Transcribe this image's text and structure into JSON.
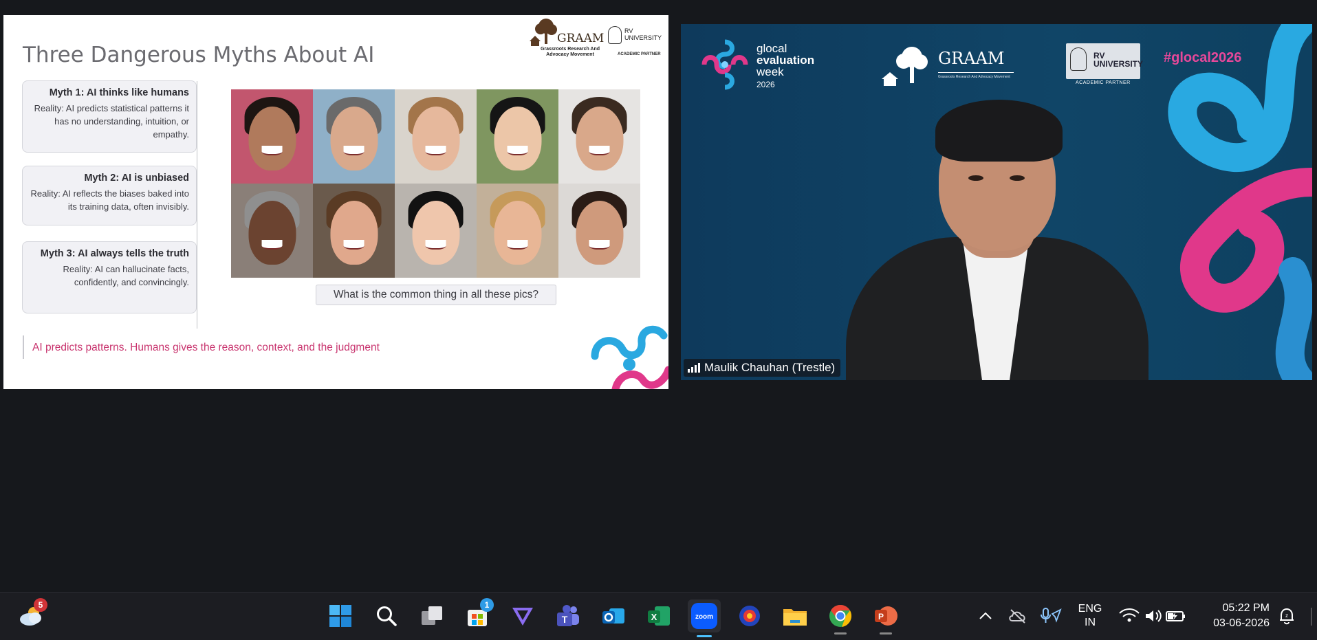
{
  "slide": {
    "title": "Three Dangerous Myths About AI",
    "logo_graam": "GRAAM",
    "logo_graam_sub": "Grassroots Research And Advocacy Movement",
    "logo_rvu": "RV UNIVERSITY",
    "logo_rvu_sub": "ACADEMIC PARTNER",
    "myths": [
      {
        "title": "Myth 1: AI thinks like humans",
        "body": "Reality: AI predicts statistical patterns it has no understanding, intuition, or empathy."
      },
      {
        "title": "Myth 2: AI is unbiased",
        "body": "Reality: AI reflects the biases baked into its training data, often invisibly."
      },
      {
        "title": "Myth 3: AI always tells the truth",
        "body": "Reality: AI can hallucinate facts, confidently, and convincingly."
      }
    ],
    "question": "What is the common thing in all these pics?",
    "footer": "AI predicts patterns. Humans gives the reason, context, and the judgment",
    "faces": [
      {
        "bg": "#c2566e",
        "skin": "#b07a5c",
        "hair": "#1d1512"
      },
      {
        "bg": "#8fb0c8",
        "skin": "#d9a98c",
        "hair": "#6a6a6a"
      },
      {
        "bg": "#d9d4cc",
        "skin": "#e6b89c",
        "hair": "#a3754a"
      },
      {
        "bg": "#7f9660",
        "skin": "#ecc6a8",
        "hair": "#151515"
      },
      {
        "bg": "#e6e4e2",
        "skin": "#d9a88a",
        "hair": "#3a2a20"
      },
      {
        "bg": "#8a7f78",
        "skin": "#6b4330",
        "hair": "#8f8f8f"
      },
      {
        "bg": "#6a5a4c",
        "skin": "#e0a88c",
        "hair": "#5a3b24"
      },
      {
        "bg": "#b9b4ae",
        "skin": "#efc6ac",
        "hair": "#121212"
      },
      {
        "bg": "#c2b099",
        "skin": "#e8b696",
        "hair": "#c69a5a"
      },
      {
        "bg": "#dcd9d6",
        "skin": "#cf9a7c",
        "hair": "#2a1c16"
      }
    ]
  },
  "video": {
    "event_line1": "glocal",
    "event_line2": "evaluation",
    "event_line3": "week",
    "event_year": "2026",
    "graam": "GRAAM",
    "graam_sub": "Grassroots Research And Advocacy Movement",
    "rvu": "RV UNIVERSITY",
    "rvu_sub": "ACADEMIC PARTNER",
    "hashtag": "#glocal2026",
    "participant_name": "Maulik Chauhan (Trestle)"
  },
  "taskbar": {
    "weather_badge": "5",
    "store_badge": "1",
    "zoom_label": "zoom",
    "lang_line1": "ENG",
    "lang_line2": "IN",
    "time": "05:22 PM",
    "date": "03-06-2026"
  },
  "colors": {
    "accent_pink": "#c9356f",
    "hashtag_pink": "#e8489a",
    "video_bg": "#0f3b5e",
    "taskbar_bg": "#1c1d22"
  }
}
